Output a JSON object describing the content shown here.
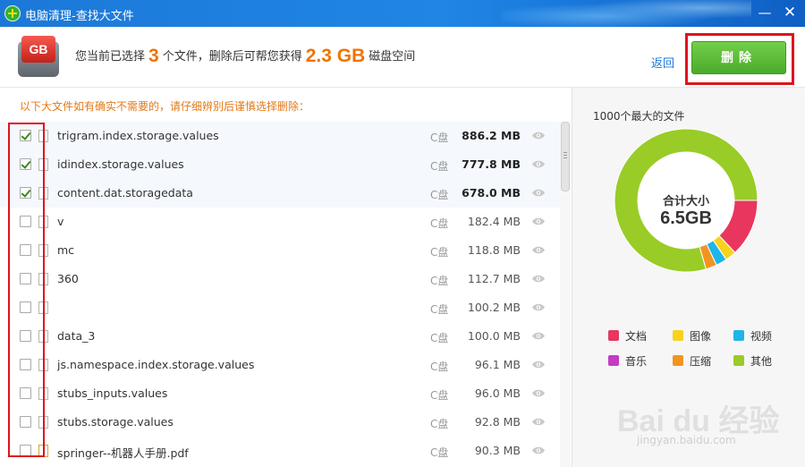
{
  "window": {
    "title": "电脑清理-查找大文件"
  },
  "header": {
    "icon_text": "GB",
    "summary_prefix": "您当前已选择",
    "selected_count": "3",
    "summary_mid": "个文件，删除后可帮您获得",
    "freed_size": "2.3 GB",
    "summary_suffix": "磁盘空间",
    "back_label": "返回",
    "delete_label": "删除"
  },
  "notice": "以下大文件如有确实不需要的，请仔细辨别后谨慎选择删除：",
  "files": [
    {
      "name": "trigram.index.storage.values",
      "drive": "C盘",
      "size": "886.2 MB",
      "checked": true
    },
    {
      "name": "idindex.storage.values",
      "drive": "C盘",
      "size": "777.8 MB",
      "checked": true
    },
    {
      "name": "content.dat.storagedata",
      "drive": "C盘",
      "size": "678.0 MB",
      "checked": true
    },
    {
      "name": "v",
      "drive": "C盘",
      "size": "182.4 MB",
      "checked": false
    },
    {
      "name": "mc",
      "drive": "C盘",
      "size": "118.8 MB",
      "checked": false
    },
    {
      "name": "360",
      "drive": "C盘",
      "size": "112.7 MB",
      "checked": false
    },
    {
      "name": "",
      "drive": "C盘",
      "size": "100.2 MB",
      "checked": false
    },
    {
      "name": "data_3",
      "drive": "C盘",
      "size": "100.0 MB",
      "checked": false
    },
    {
      "name": "js.namespace.index.storage.values",
      "drive": "C盘",
      "size": "96.1 MB",
      "checked": false
    },
    {
      "name": "stubs_inputs.values",
      "drive": "C盘",
      "size": "96.0 MB",
      "checked": false
    },
    {
      "name": "stubs.storage.values",
      "drive": "C盘",
      "size": "92.8 MB",
      "checked": false
    },
    {
      "name": "springer--机器人手册.pdf",
      "drive": "C盘",
      "size": "90.3 MB",
      "checked": false,
      "pdf": true
    }
  ],
  "panel": {
    "title": "1000个最大的文件",
    "total_label": "合计大小",
    "total_value": "6.5GB"
  },
  "chart_data": {
    "type": "pie",
    "title": "",
    "categories": [
      "文档",
      "图像",
      "视频",
      "音乐",
      "压缩",
      "其他"
    ],
    "values": [
      13,
      2.5,
      2.5,
      0,
      2.5,
      79.5
    ],
    "colors": [
      "#e8365f",
      "#f6d31d",
      "#1fb5e8",
      "#c53ac6",
      "#f39421",
      "#99cc26"
    ],
    "legend": "bottom"
  },
  "watermark": {
    "main": "Bai du 经验",
    "sub": "jingyan.baidu.com"
  }
}
